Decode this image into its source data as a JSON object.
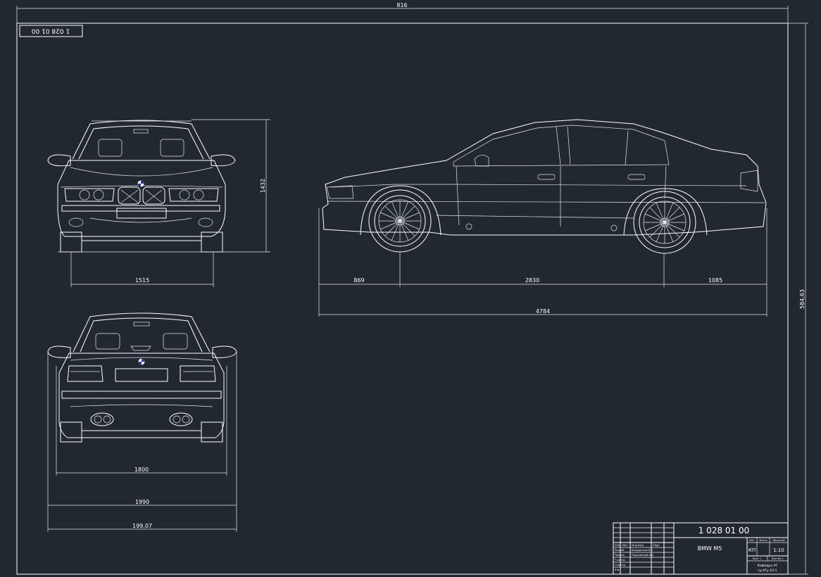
{
  "sheet": {
    "top_dimension": "816",
    "right_dimension": "584,63",
    "stamp_code": "1 028 01 00"
  },
  "front_view": {
    "height_dim": "1432",
    "track_dim": "1515"
  },
  "side_view": {
    "front_overhang": "869",
    "wheelbase": "2830",
    "rear_overhang": "1085",
    "total_length": "4784"
  },
  "rear_view": {
    "track_dim": "1800",
    "width_dim": "1990",
    "overall_width_dim": "199,07"
  },
  "title_block": {
    "doc_number": "1 028 01 00",
    "name": "BMW M5",
    "scale": "1:10",
    "lit_label": "Лит.",
    "mass_label": "Масса",
    "scale_label": "Масштаб",
    "lit_value": "КП",
    "sheet_label": "Лист 1",
    "sheets_label": "Листов 1",
    "org_line1": "Кафедра АТ",
    "org_line2": "гр.АТу-10-1",
    "rows": [
      {
        "role": "Изм",
        "name": "Лист",
        "sig": "№ докум.",
        "date": "Подп"
      },
      {
        "role": "Разраб.",
        "name": "Кондратьев В.А.",
        "sig": "",
        "date": ""
      },
      {
        "role": "Провер.",
        "name": "Пашковский А.Н.",
        "sig": "",
        "date": ""
      },
      {
        "role": "Т.контр.",
        "name": "",
        "sig": "",
        "date": ""
      },
      {
        "role": "Н.контр.",
        "name": "",
        "sig": "",
        "date": ""
      },
      {
        "role": "Утв.",
        "name": "",
        "sig": "",
        "date": ""
      }
    ]
  }
}
